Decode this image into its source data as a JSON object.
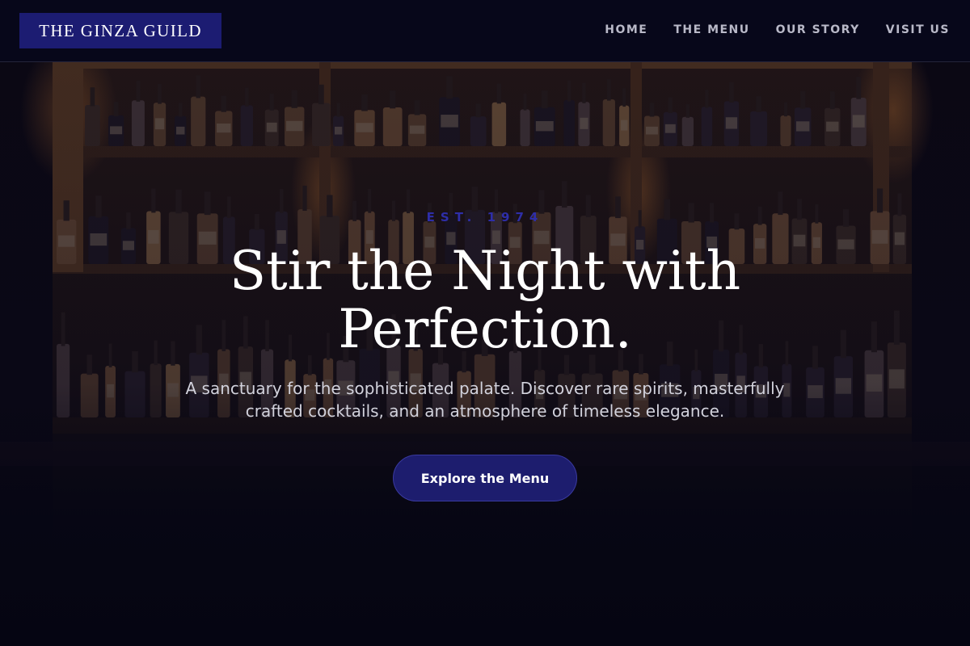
{
  "header": {
    "brand": "THE GINZA GUILD",
    "nav": [
      {
        "label": "HOME"
      },
      {
        "label": "THE MENU"
      },
      {
        "label": "OUR STORY"
      },
      {
        "label": "VISIT US"
      }
    ]
  },
  "hero": {
    "eyebrow": "EST. 1974",
    "headline_line1": "Stir the Night with",
    "headline_line2": "Perfection.",
    "subtitle": "A sanctuary for the sophisticated palate. Discover rare spirits, masterfully crafted cocktails, and an atmosphere of timeless elegance.",
    "cta_label": "Explore the Menu"
  },
  "colors": {
    "background": "#06061a",
    "brand_accent": "#1c1c72",
    "eyebrow": "#2e2ea8"
  }
}
